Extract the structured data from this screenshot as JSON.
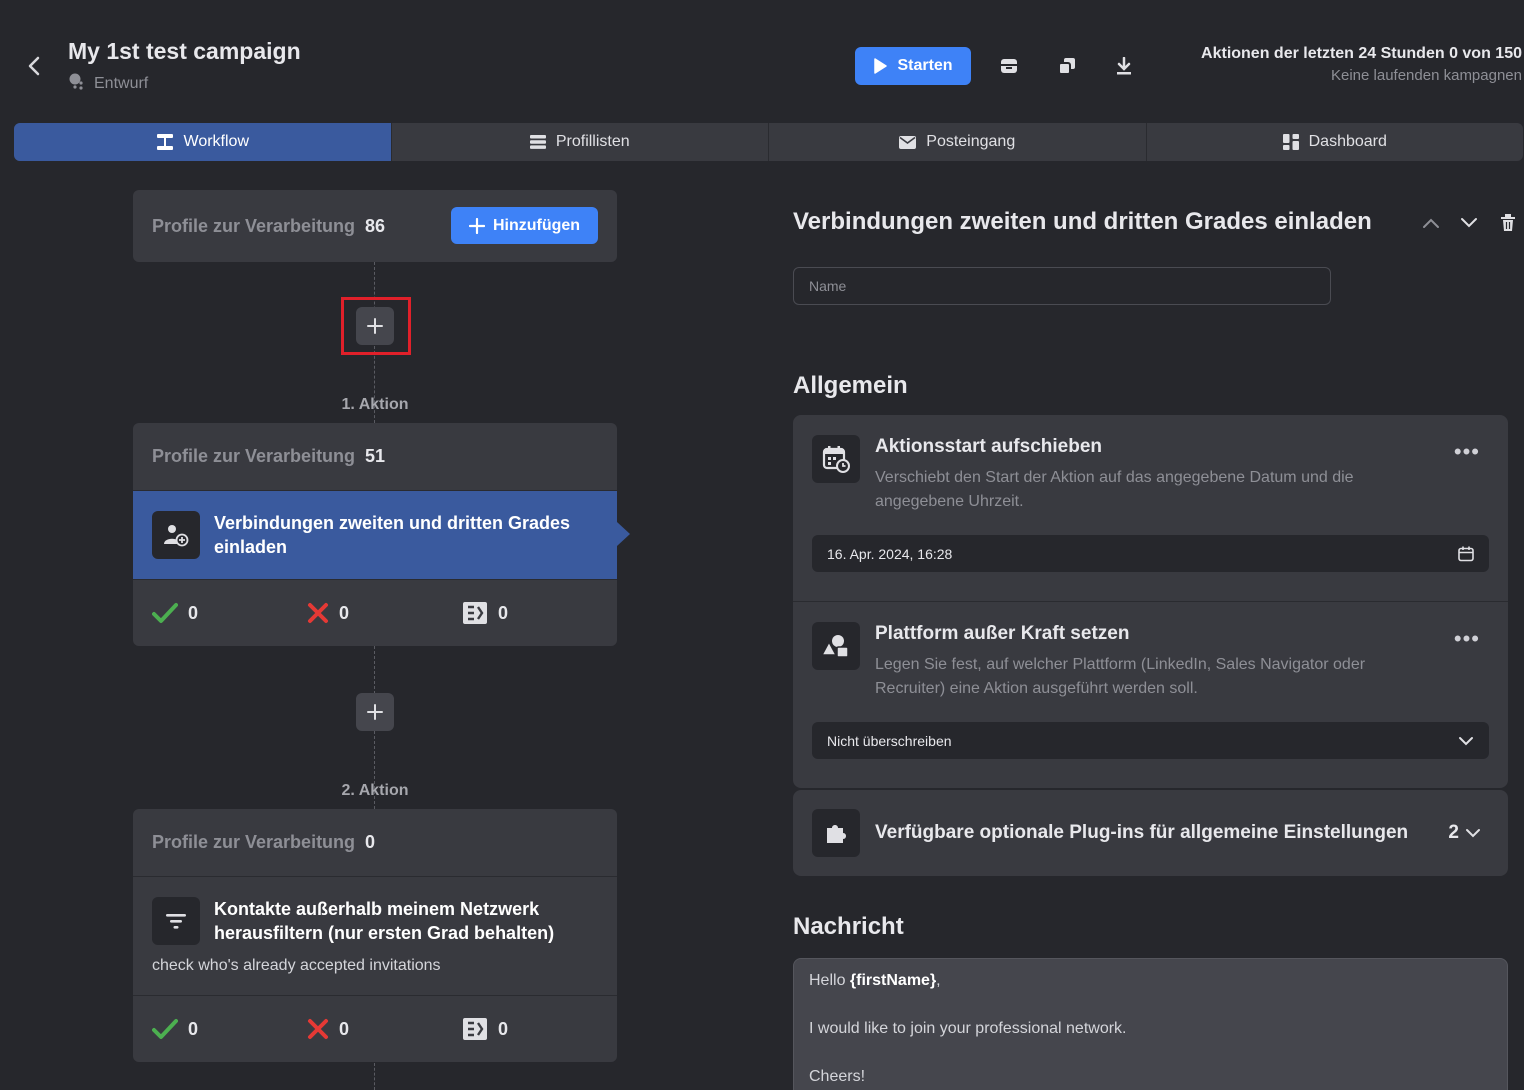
{
  "header": {
    "title": "My 1st test campaign",
    "status": "Entwurf",
    "start_label": "Starten",
    "actions_line": "Aktionen der letzten 24 Stunden 0 von 150",
    "running_line": "Keine laufenden kampagnen"
  },
  "tabs": [
    {
      "label": "Workflow",
      "icon": "workflow-icon",
      "active": true
    },
    {
      "label": "Profillisten",
      "icon": "list-icon",
      "active": false
    },
    {
      "label": "Posteingang",
      "icon": "mail-icon",
      "active": false
    },
    {
      "label": "Dashboard",
      "icon": "dashboard-icon",
      "active": false
    }
  ],
  "workflow": {
    "source": {
      "label": "Profile zur Verarbeitung",
      "count": "86",
      "add_label": "Hinzufügen"
    },
    "actions": [
      {
        "label": "1. Aktion",
        "profiles_label": "Profile zur Verarbeitung",
        "count": "51",
        "step_title": "Verbindungen zweiten und dritten Grades einladen",
        "note": "",
        "stats": {
          "success": "0",
          "failed": "0",
          "skipped": "0"
        }
      },
      {
        "label": "2. Aktion",
        "profiles_label": "Profile zur Verarbeitung",
        "count": "0",
        "step_title": "Kontakte außerhalb meinem Netzwerk herausfiltern (nur ersten Grad behalten)",
        "note": "check who's already accepted invitations",
        "stats": {
          "success": "0",
          "failed": "0",
          "skipped": "0"
        }
      }
    ]
  },
  "detail": {
    "title": "Verbindungen zweiten und dritten Grades einladen",
    "name_placeholder": "Name",
    "general_heading": "Allgemein",
    "delay": {
      "title": "Aktionsstart aufschieben",
      "desc": "Verschiebt den Start der Aktion auf das angegebene Datum und die angegebene Uhrzeit.",
      "value": "16. Apr. 2024, 16:28"
    },
    "platform": {
      "title": "Plattform außer Kraft setzen",
      "desc": "Legen Sie fest, auf welcher Plattform (LinkedIn, Sales Navigator oder Recruiter) eine Aktion ausgeführt werden soll.",
      "value": "Nicht überschreiben"
    },
    "plugins": {
      "title": "Verfügbare optionale Plug-ins für allgemeine Einstellungen",
      "count": "2"
    },
    "message_heading": "Nachricht",
    "message": {
      "greeting": "Hello ",
      "variable": "{firstName}",
      "comma": ",",
      "line2": "I would like to join your professional network.",
      "line3": "Cheers!"
    }
  },
  "colors": {
    "accent": "#3e82f7",
    "selected": "#3a5a9e",
    "success": "#4caf50",
    "failed": "#e53935"
  }
}
